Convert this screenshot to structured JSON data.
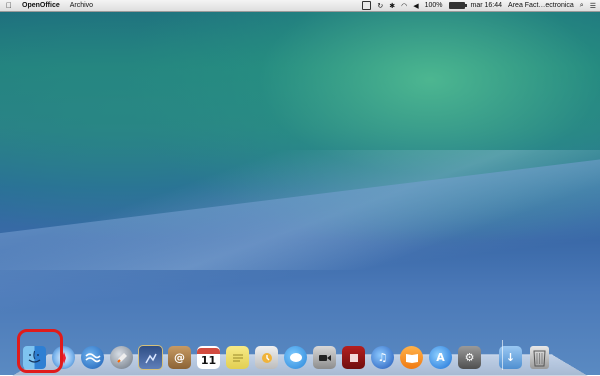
{
  "menubar": {
    "app_name": "OpenOffice",
    "menus": [
      "Archivo"
    ],
    "battery_percent": "100%",
    "clock": "mar 16:44",
    "user_label": "Area Fact…ectronica"
  },
  "dock": {
    "apps": [
      {
        "name": "Finder",
        "icon": "finder-icon"
      },
      {
        "name": "Safari",
        "icon": "safari-icon"
      },
      {
        "name": "OpenOffice",
        "icon": "openoffice-icon"
      },
      {
        "name": "Launchpad",
        "icon": "launchpad-icon"
      },
      {
        "name": "Preview",
        "icon": "preview-icon"
      },
      {
        "name": "Contacts",
        "icon": "contacts-icon"
      },
      {
        "name": "Calendar",
        "icon": "calendar-icon",
        "badge": "11"
      },
      {
        "name": "Notes",
        "icon": "notes-icon"
      },
      {
        "name": "Photo Booth",
        "icon": "photobooth-icon"
      },
      {
        "name": "Messages",
        "icon": "messages-icon"
      },
      {
        "name": "FaceTime",
        "icon": "facetime-icon"
      },
      {
        "name": "Photo Booth",
        "icon": "photo-icon"
      },
      {
        "name": "iTunes",
        "icon": "itunes-icon"
      },
      {
        "name": "iBooks",
        "icon": "ibooks-icon"
      },
      {
        "name": "App Store",
        "icon": "appstore-icon"
      },
      {
        "name": "System Preferences",
        "icon": "system-preferences-icon"
      }
    ],
    "stacks": [
      {
        "name": "Downloads",
        "icon": "downloads-icon"
      },
      {
        "name": "Trash",
        "icon": "trash-icon"
      }
    ],
    "highlighted_item": "Finder",
    "highlight_color": "#e01b1b"
  }
}
